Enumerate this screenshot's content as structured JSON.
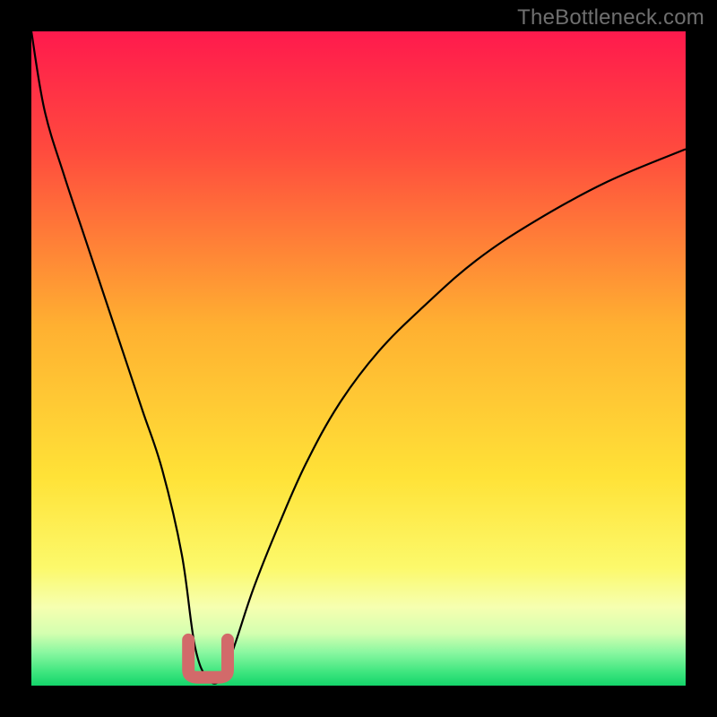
{
  "watermark": "TheBottleneck.com",
  "chart_data": {
    "type": "line",
    "title": "",
    "xlabel": "",
    "ylabel": "",
    "xrange": [
      0,
      100
    ],
    "yrange": [
      0,
      100
    ],
    "note": "Bottleneck-style curve: V-shaped black curve on rainbow gradient. Minimum (~0%) occurs near x≈27%. Pink marker highlights the valley bottom.",
    "series": [
      {
        "name": "bottleneck-curve",
        "x": [
          0,
          2,
          5,
          8,
          11,
          14,
          17,
          20,
          23,
          25,
          27,
          29,
          31,
          34,
          38,
          42,
          47,
          53,
          60,
          68,
          77,
          88,
          100
        ],
        "y": [
          100,
          88,
          78,
          69,
          60,
          51,
          42,
          33,
          20,
          6,
          1,
          1,
          6,
          15,
          25,
          34,
          43,
          51,
          58,
          65,
          71,
          77,
          82
        ]
      }
    ],
    "marker": {
      "x_from": 24,
      "x_to": 30,
      "y": 1
    },
    "gradient_stops": [
      {
        "pct": 0,
        "color": "#ff1a4d"
      },
      {
        "pct": 18,
        "color": "#ff4a3e"
      },
      {
        "pct": 45,
        "color": "#ffb031"
      },
      {
        "pct": 68,
        "color": "#ffe237"
      },
      {
        "pct": 82,
        "color": "#fcf96b"
      },
      {
        "pct": 88,
        "color": "#f6ffb0"
      },
      {
        "pct": 92,
        "color": "#d4ffb0"
      },
      {
        "pct": 95,
        "color": "#88f7a0"
      },
      {
        "pct": 98,
        "color": "#3de57e"
      },
      {
        "pct": 100,
        "color": "#14d46a"
      }
    ]
  }
}
